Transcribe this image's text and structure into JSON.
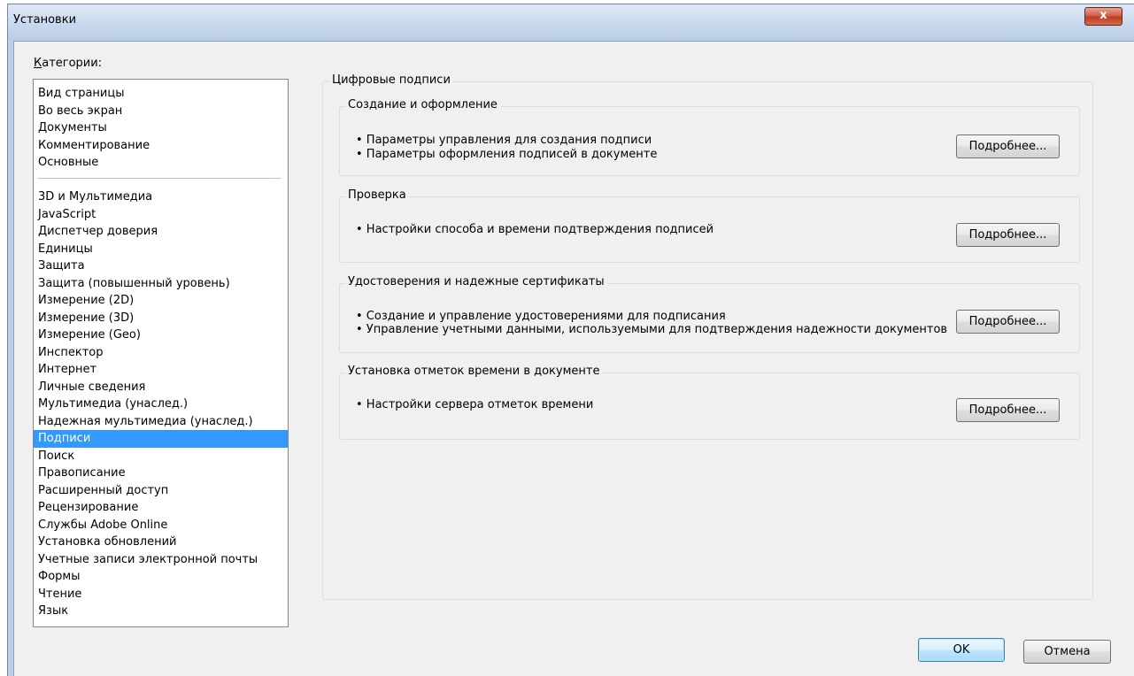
{
  "window": {
    "title": "Установки",
    "close_label": "x"
  },
  "categories_label": "Категории:",
  "categories_label_mnemonic": "К",
  "categories_label_rest": "атегории:",
  "categories": {
    "top_group": [
      "Вид страницы",
      "Во весь экран",
      "Документы",
      "Комментирование",
      "Основные"
    ],
    "main_group": [
      "3D и Мультимедиа",
      "JavaScript",
      "Диспетчер доверия",
      "Единицы",
      "Защита",
      "Защита (повышенный уровень)",
      "Измерение (2D)",
      "Измерение (3D)",
      "Измерение (Geo)",
      "Инспектор",
      "Интернет",
      "Личные сведения",
      "Мультимедиа (унаслед.)",
      "Надежная мультимедиа (унаслед.)",
      "Подписи",
      "Поиск",
      "Правописание",
      "Расширенный доступ",
      "Рецензирование",
      "Службы Adobe Online",
      "Установка обновлений",
      "Учетные записи электронной почты",
      "Формы",
      "Чтение",
      "Язык"
    ],
    "selected": "Подписи"
  },
  "panel": {
    "title": "Цифровые подписи",
    "sections": [
      {
        "title": "Создание и оформление",
        "bullets": [
          "• Параметры управления для создания подписи",
          "• Параметры оформления подписей в документе"
        ],
        "button": "Подробнее..."
      },
      {
        "title": "Проверка",
        "bullets": [
          "• Настройки способа и времени подтверждения подписей"
        ],
        "button": "Подробнее..."
      },
      {
        "title": "Удостоверения и надежные сертификаты",
        "bullets": [
          "• Создание и управление удостоверениями для подписания",
          "• Управление учетными данными, используемыми для подтверждения надежности документов"
        ],
        "button": "Подробнее..."
      },
      {
        "title": "Установка отметок времени в документе",
        "bullets": [
          "• Настройки сервера отметок времени"
        ],
        "button": "Подробнее..."
      }
    ]
  },
  "footer": {
    "ok_label": "OK",
    "cancel_label": "Отмена"
  },
  "colors": {
    "selection": "#3399ff",
    "window_frame": "#bcd1e8",
    "dialog_bg": "#f0f0f0",
    "close_button": "#c23c22"
  }
}
